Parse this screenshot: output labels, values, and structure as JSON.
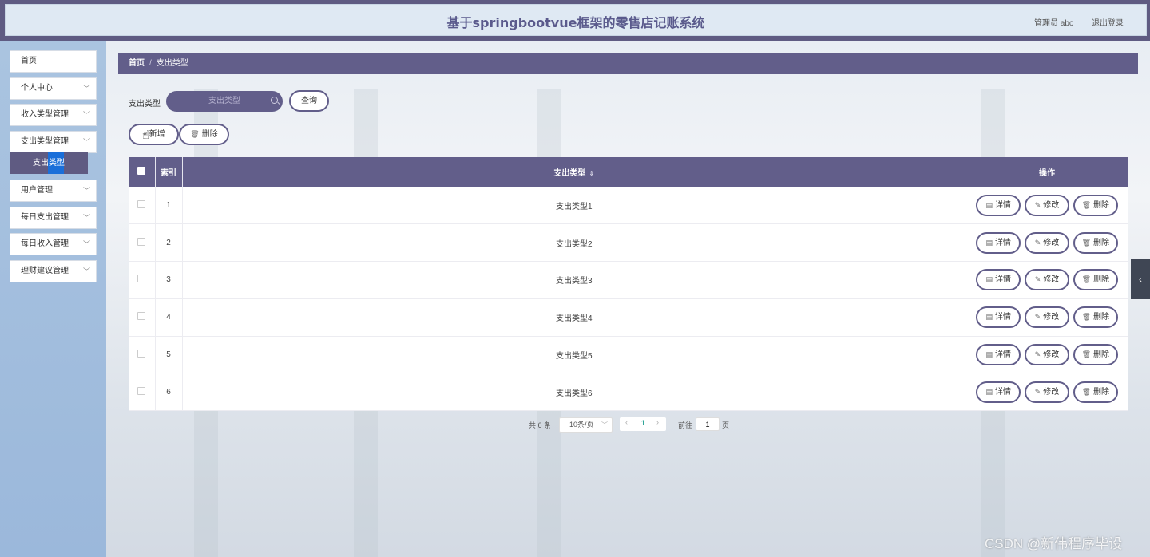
{
  "header": {
    "title": "基于springbootvue框架的零售店记账系统",
    "admin": "管理员 abo",
    "logout": "退出登录"
  },
  "sidebar": {
    "items": [
      {
        "label": "首页",
        "has_arrow": false
      },
      {
        "label": "个人中心",
        "has_arrow": true
      },
      {
        "label": "收入类型管理",
        "has_arrow": true
      },
      {
        "label": "支出类型管理",
        "has_arrow": true,
        "expanded": true
      },
      {
        "label": "用户管理",
        "has_arrow": true
      },
      {
        "label": "每日支出管理",
        "has_arrow": true
      },
      {
        "label": "每日收入管理",
        "has_arrow": true
      },
      {
        "label": "理财建议管理",
        "has_arrow": true
      }
    ],
    "active_subitem": "支出类型"
  },
  "breadcrumb": {
    "home": "首页",
    "separator": "/",
    "current": "支出类型"
  },
  "search": {
    "label": "支出类型",
    "placeholder": "支出类型",
    "value": "",
    "button": "查询"
  },
  "toolbar": {
    "add_label": "新增",
    "delete_label": "删除"
  },
  "table": {
    "headers": {
      "index": "索引",
      "type": "支出类型",
      "actions": "操作"
    },
    "rows": [
      {
        "index": "1",
        "type": "支出类型1"
      },
      {
        "index": "2",
        "type": "支出类型2"
      },
      {
        "index": "3",
        "type": "支出类型3"
      },
      {
        "index": "4",
        "type": "支出类型4"
      },
      {
        "index": "5",
        "type": "支出类型5"
      },
      {
        "index": "6",
        "type": "支出类型6"
      }
    ],
    "action_labels": {
      "detail": "详情",
      "edit": "修改",
      "delete": "删除"
    }
  },
  "pagination": {
    "total_text": "共 6 条",
    "page_size": "10条/页",
    "current_page": "1",
    "goto_label": "前往",
    "goto_value": "1",
    "page_unit": "页"
  },
  "watermark": "CSDN @新伟程序毕设",
  "colors": {
    "accent": "#625e8a",
    "header_bg": "#dfe9f3",
    "sidebar_bg": "#9bb8db",
    "active_page": "#1a9c8d"
  }
}
